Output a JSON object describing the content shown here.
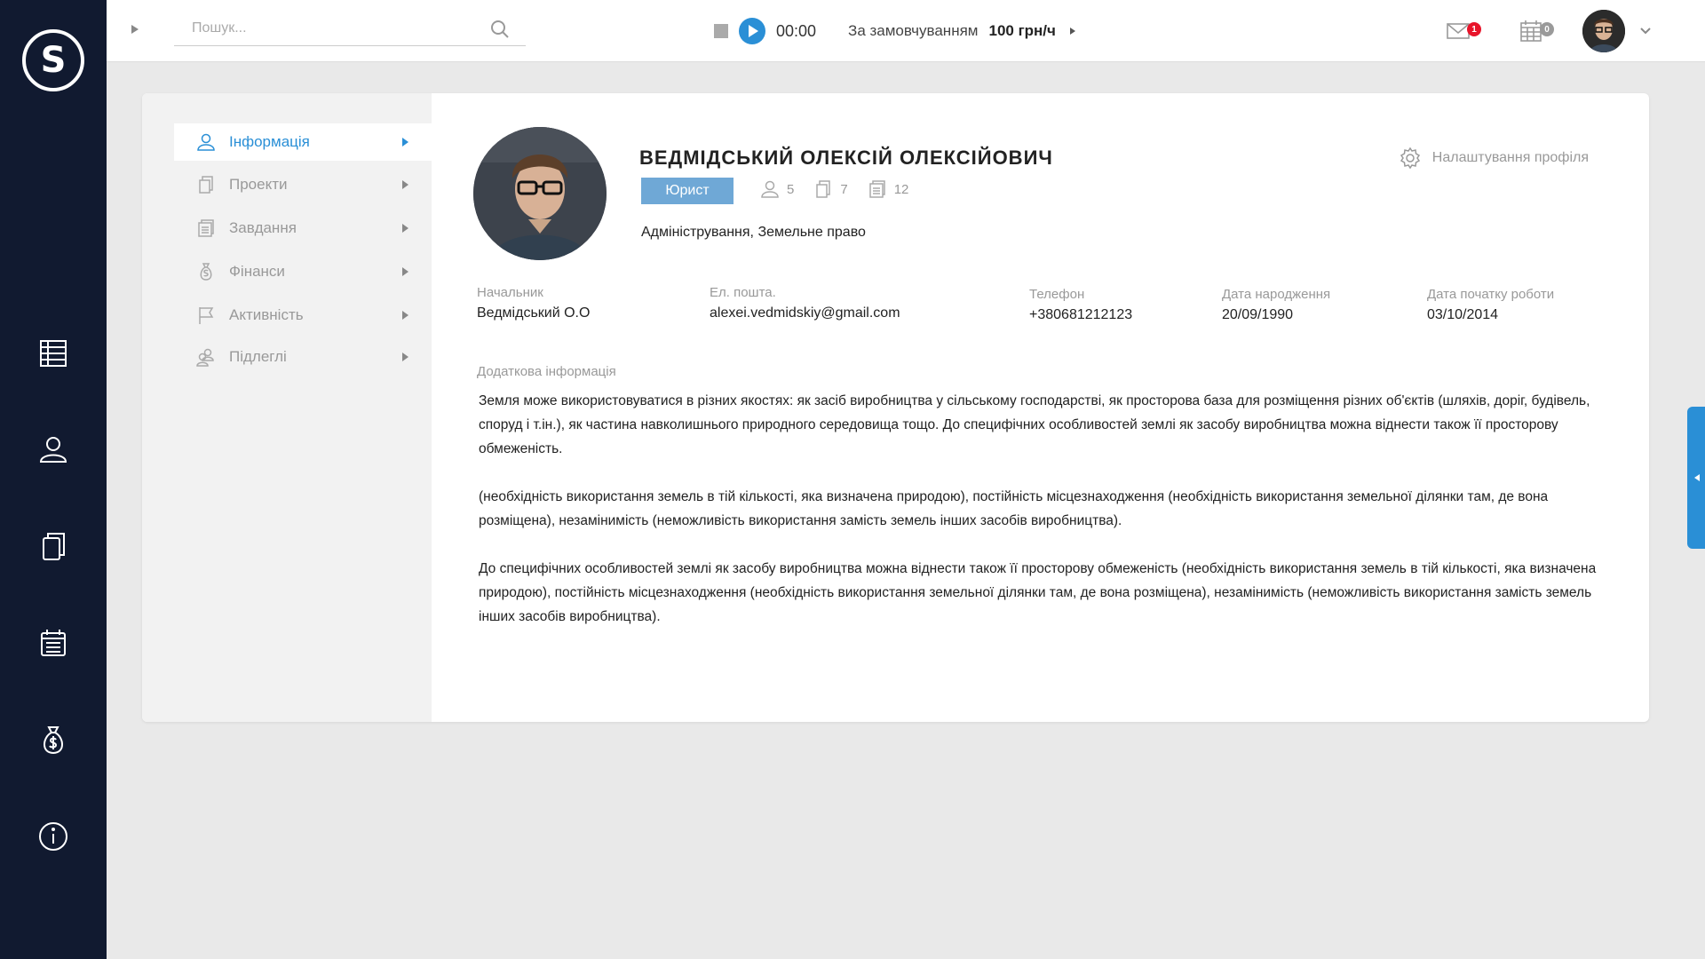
{
  "rail": {
    "logo_letter": "S",
    "items": [
      "table-icon",
      "user-icon",
      "documents-icon",
      "calendar-icon",
      "money-bag-icon",
      "info-icon"
    ]
  },
  "topbar": {
    "search_placeholder": "Пошук...",
    "timer": "00:00",
    "rate_label": "За замовчуванням",
    "rate_value": "100 грн/ч",
    "mail_count": "1",
    "calendar_count": "0",
    "colors": {
      "accent": "#2a8fd6",
      "mail_badge": "#e8142a",
      "calendar_badge": "#9a9a9a"
    }
  },
  "sidebar": {
    "items": [
      {
        "label": "Інформація",
        "icon": "user-icon",
        "active": true
      },
      {
        "label": "Проекти",
        "icon": "documents-icon",
        "active": false
      },
      {
        "label": "Завдання",
        "icon": "tasks-icon",
        "active": false
      },
      {
        "label": "Фінанси",
        "icon": "money-bag-icon",
        "active": false
      },
      {
        "label": "Активність",
        "icon": "flag-icon",
        "active": false
      },
      {
        "label": "Підлеглі",
        "icon": "users-icon",
        "active": false
      }
    ]
  },
  "profile": {
    "name": "ВЕДМІДСЬКИЙ ОЛЕКСІЙ ОЛЕКСІЙОВИЧ",
    "role": "Юрист",
    "stats": {
      "users": "5",
      "projects": "7",
      "tasks": "12"
    },
    "specialization": "Адміністрування, Земельне право",
    "settings_label": "Налаштування профіля",
    "fields": {
      "chief": {
        "label": "Начальник",
        "value": "Ведмідський О.О"
      },
      "email": {
        "label": "Ел. пошта.",
        "value": "alexei.vedmidskiy@gmail.com"
      },
      "phone": {
        "label": "Телефон",
        "value": "+380681212123"
      },
      "birth": {
        "label": "Дата народження",
        "value": "20/09/1990"
      },
      "start": {
        "label": "Дата початку роботи",
        "value": "03/10/2014"
      }
    },
    "extra_label": "Додаткова інформація",
    "extra_paragraphs": [
      "Земля може використовуватися в різних якостях: як засіб виробництва у сільському господарстві, як просторова база для розміщення різних об'єктів (шляхів, доріг, будівель, споруд і т.ін.), як частина навколишнього природного середовища тощо. До специфічних особливостей землі як засобу виробництва можна віднести також її просторову обмеженість.",
      "(необхідність використання земель в тій кількості, яка визначена природою), постійність місцезнаходження (необхідність використання земельної ділянки там, де вона розміщена), незамінимість (неможливість використання замість земель інших засобів виробництва).",
      "До специфічних особливостей землі як засобу виробництва можна віднести також її просторову обмеженість (необхідність використання земель в тій кількості, яка визначена природою), постійність місцезнаходження (необхідність використання земельної ділянки там, де вона розміщена), незамінимість (неможливість використання замість земель інших засобів виробництва)."
    ]
  }
}
